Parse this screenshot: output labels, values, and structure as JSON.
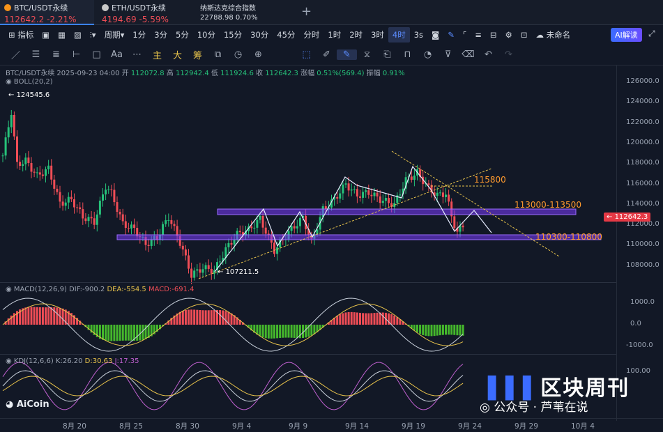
{
  "tabs": [
    {
      "name": "BTC/USDT永续",
      "price": "112642.2",
      "change": "-2.21%"
    },
    {
      "name": "ETH/USDT永续",
      "price": "4194.69",
      "change": "-5.59%"
    },
    {
      "name": "纳斯达克综合指数",
      "price": "22788.98",
      "change": "0.70%"
    }
  ],
  "toolbar": {
    "indicator": "指标",
    "period": "周期",
    "intervals": [
      "1分",
      "3分",
      "5分",
      "10分",
      "15分",
      "30分",
      "45分",
      "分时",
      "1时",
      "2时",
      "3时",
      "4时"
    ],
    "selected_interval": "4时",
    "seconds": "3s",
    "unnamed": "未命名",
    "ai": "AI解读"
  },
  "drawbar": {
    "main": "主",
    "big": "大",
    "chip": "筹",
    "text": "Aa"
  },
  "info": {
    "symbol": "BTC/USDT永续",
    "time": "2025-09-23 04:00",
    "open_label": "开",
    "open": "112072.8",
    "high_label": "高",
    "high": "112942.4",
    "low_label": "低",
    "low": "111924.6",
    "close_label": "收",
    "close": "112642.3",
    "chg_label": "涨幅",
    "chg": "0.51%(569.4)",
    "amp_label": "振幅",
    "amp": "0.91%"
  },
  "boll": "BOLL(20,2)",
  "macd": {
    "name": "MACD(12,26,9)",
    "dif": "DIF:-900.2",
    "dea": "DEA:-554.5",
    "macd": "MACD:-691.4"
  },
  "kdj": {
    "name": "KDJ(12,6,6)",
    "k": "K:26.20",
    "d": "D:30.63",
    "j": "J:17.35"
  },
  "price_axis": [
    "126000.0",
    "124000.0",
    "122000.0",
    "120000.0",
    "118000.0",
    "116000.0",
    "114000.0",
    "112000.0",
    "110000.0",
    "108000.0"
  ],
  "macd_axis": [
    "1000.0",
    "0.0",
    "-1000.0"
  ],
  "kdj_axis": [
    "100.00"
  ],
  "current_price": "112642.3",
  "high_marker": "124545.6",
  "low_marker": "107211.5",
  "annotations": {
    "level1": "115800",
    "zone1": "113000-113500",
    "zone2": "110300-110800"
  },
  "x_axis": [
    "8月 20",
    "8月 25",
    "8月 30",
    "9月 4",
    "9月 9",
    "9月 14",
    "9月 19",
    "9月 24",
    "9月 29",
    "10月 4"
  ],
  "watermark": "AiCoin",
  "brand": "区块周刊",
  "wechat": "公众号 · 芦苇在说",
  "colors": {
    "up": "#26c27a",
    "down": "#ef4d56",
    "accent": "#3b82f6",
    "zone": "#7a3cff",
    "trend": "#e8c34b"
  }
}
